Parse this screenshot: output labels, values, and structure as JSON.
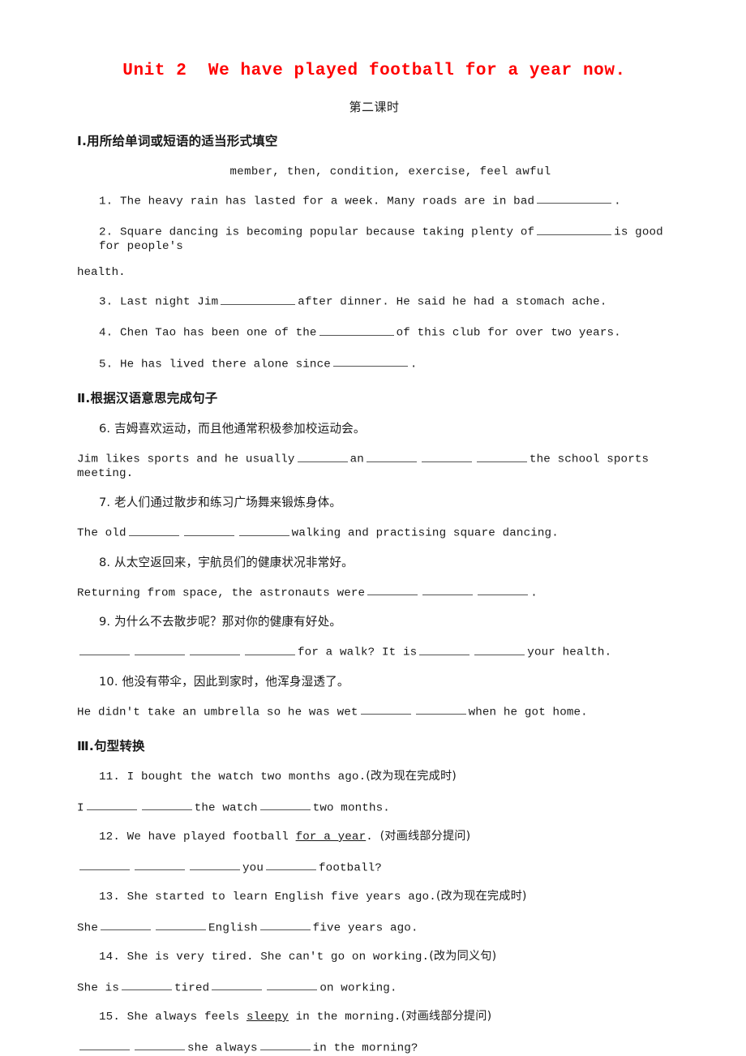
{
  "title": "Unit 2  We have played football for a year now.",
  "subtitle": "第二课时",
  "sections": [
    {
      "heading": "Ⅰ.用所给单词或短语的适当形式填空",
      "wordbank": "member, then, condition, exercise, feel awful"
    },
    {
      "heading": "Ⅱ.根据汉语意思完成句子"
    },
    {
      "heading": "Ⅲ.句型转换"
    }
  ],
  "items": {
    "q1a": "1. The heavy rain has lasted for a week. Many roads are in bad",
    "q1b": ".",
    "q2a": "2. Square dancing is becoming popular because taking plenty of",
    "q2b": "is good for people's",
    "q2c": "health.",
    "q3a": "3. Last night Jim",
    "q3b": "after dinner. He said he had a stomach ache.",
    "q4a": "4. Chen Tao has been one of the",
    "q4b": "of this club for over two years.",
    "q5a": "5. He has lived there alone since",
    "q5b": ".",
    "q6cn": "6. 吉姆喜欢运动，而且他通常积极参加校运动会。",
    "q6a": "Jim likes sports and he usually",
    "q6b": "an",
    "q6c": "the school sports meeting.",
    "q7cn": "7. 老人们通过散步和练习广场舞来锻炼身体。",
    "q7a": "The old",
    "q7b": "walking and practising square dancing.",
    "q8cn": "8. 从太空返回来，宇航员们的健康状况非常好。",
    "q8a": "Returning from space, the astronauts were",
    "q8b": ".",
    "q9cn": "9. 为什么不去散步呢？那对你的健康有好处。",
    "q9a": "for a walk? It is",
    "q9b": "your health.",
    "q10cn": "10. 他没有带伞，因此到家时，他浑身湿透了。",
    "q10a": "He didn't take an umbrella so he was wet",
    "q10b": "when he got home.",
    "q11a": "11. I bought the watch two months ago.",
    "q11cn": "(改为现在完成时)",
    "q11b": "I",
    "q11c": "the watch",
    "q11d": "two months.",
    "q12a": "12. We have played football ",
    "q12u": "for a year",
    "q12b": ".",
    "q12cn": "(对画线部分提问)",
    "q12c": "you",
    "q12d": "football?",
    "q13a": "13. She started to learn English five years ago.",
    "q13cn": "(改为现在完成时)",
    "q13b": "She",
    "q13c": "English",
    "q13d": "five years ago.",
    "q14a": "14. She is very tired. She can't go on working.",
    "q14cn": "(改为同义句)",
    "q14b": "She is",
    "q14c": "tired",
    "q14d": "on working.",
    "q15a": "15. She always feels ",
    "q15u": "sleepy",
    "q15b": " in the morning.",
    "q15cn": "(对画线部分提问)",
    "q15c": "she always",
    "q15d": "in the morning?"
  },
  "colors": {
    "title_red": "#ff0000",
    "text": "#1a1a1a",
    "blank_rule": "#555555"
  }
}
